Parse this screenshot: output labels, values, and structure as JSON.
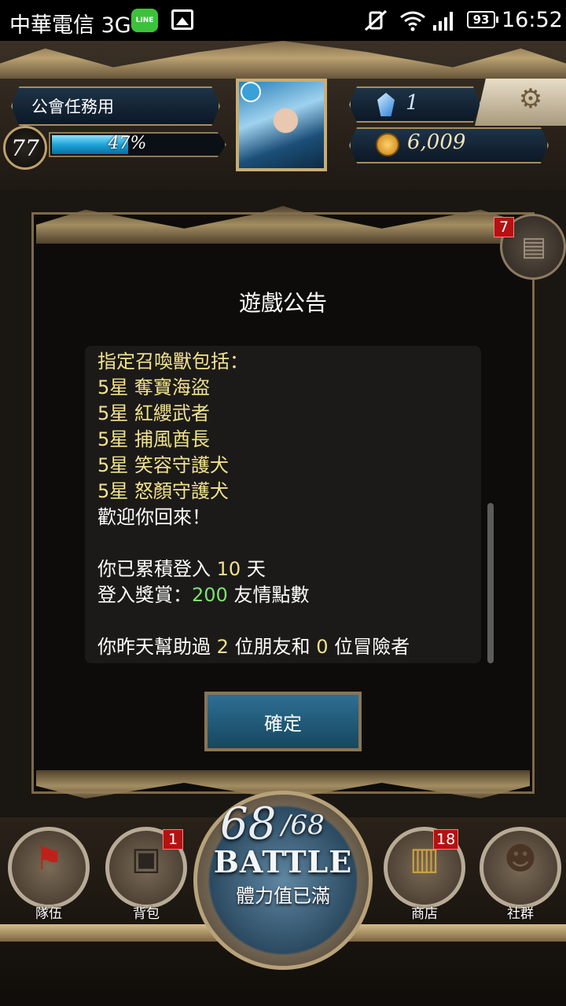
{
  "status_bar": {
    "carrier": "中華電信 3G",
    "line_app": "LINE",
    "battery": "93",
    "time": "16:52"
  },
  "header": {
    "guild_name": "公會任務用",
    "level": "77",
    "exp_percent_text": "47%",
    "exp_fraction": 0.47,
    "gems": "1",
    "coins": "6,009"
  },
  "dialog": {
    "title": "遊戲公告",
    "mail_badge": "7",
    "notice": {
      "summon_header": "指定召喚獸包括：",
      "summons": [
        "5星 奪寶海盜",
        "5星 紅纓武者",
        "5星 捕風酋長",
        "5星 笑容守護犬",
        "5星 怒顏守護犬"
      ],
      "welcome": "歡迎你回來！",
      "login_prefix": "你已累積登入 ",
      "login_days": "10",
      "login_suffix": " 天",
      "reward_prefix": "登入獎賞：",
      "reward_amount": "200",
      "reward_suffix": " 友情點數",
      "help_prefix": "你昨天幫助過 ",
      "help_friends": "2",
      "help_middle": " 位朋友和 ",
      "help_adventurers": "0",
      "help_suffix": " 位冒險者"
    },
    "confirm_label": "確定"
  },
  "nav": {
    "team_label": "隊伍",
    "bag_label": "背包",
    "bag_badge": "1",
    "shop_label": "商店",
    "shop_badge": "18",
    "social_label": "社群",
    "stamina_current": "68",
    "stamina_max": "/68",
    "battle_label": "BATTLE",
    "stamina_status": "體力值已滿"
  },
  "colors": {
    "highlight_gold": "#f2e28a",
    "highlight_green": "#7de26e",
    "badge_red": "#b41212"
  }
}
